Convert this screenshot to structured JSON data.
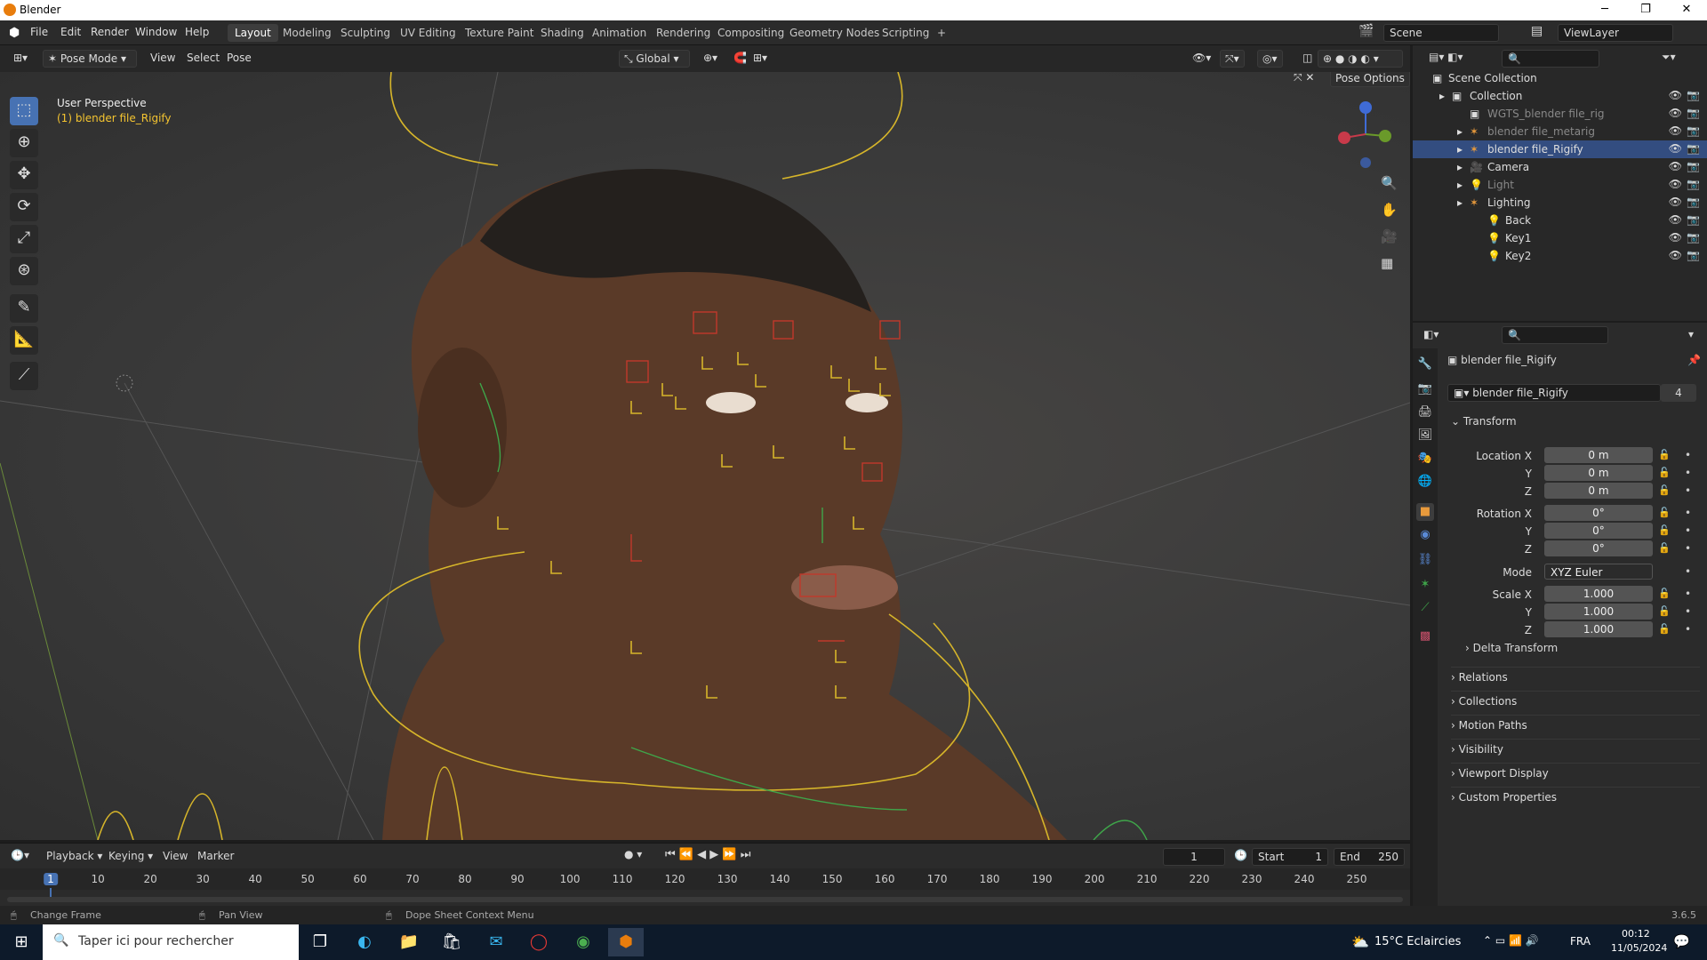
{
  "titlebar": {
    "title": "Blender",
    "min": "─",
    "max": "❐",
    "close": "✕"
  },
  "menus": [
    "File",
    "Edit",
    "Render",
    "Window",
    "Help"
  ],
  "workspaces": [
    "Layout",
    "Modeling",
    "Sculpting",
    "UV Editing",
    "Texture Paint",
    "Shading",
    "Animation",
    "Rendering",
    "Compositing",
    "Geometry Nodes",
    "Scripting",
    "+"
  ],
  "scene": {
    "label": "Scene",
    "viewlayer": "ViewLayer"
  },
  "viewport_header": {
    "mode": "Pose Mode",
    "view": "View",
    "select": "Select",
    "pose": "Pose",
    "orientation": "Global",
    "pose_options": "Pose Options",
    "x": "X"
  },
  "viewport": {
    "perspective": "User Perspective",
    "object": "(1) blender file_Rigify"
  },
  "outliner": {
    "root": "Scene Collection",
    "rows": [
      {
        "label": "Collection",
        "indent": 0,
        "type": "collection"
      },
      {
        "label": "WGTS_blender file_rig",
        "indent": 1,
        "type": "collection",
        "dim": true
      },
      {
        "label": "blender file_metarig",
        "indent": 1,
        "type": "armature",
        "dim": true
      },
      {
        "label": "blender file_Rigify",
        "indent": 1,
        "type": "armature",
        "selected": true
      },
      {
        "label": "Camera",
        "indent": 1,
        "type": "camera"
      },
      {
        "label": "Light",
        "indent": 1,
        "type": "light",
        "dim": true
      },
      {
        "label": "Lighting",
        "indent": 1,
        "type": "armature"
      },
      {
        "label": "Back",
        "indent": 2,
        "type": "light"
      },
      {
        "label": "Key1",
        "indent": 2,
        "type": "light"
      },
      {
        "label": "Key2",
        "indent": 2,
        "type": "light"
      }
    ]
  },
  "properties": {
    "object_name": "blender file_Rigify",
    "datablock": "blender file_Rigify",
    "users": "4",
    "transform_title": "Transform",
    "location": {
      "label": "Location X",
      "x": "0 m",
      "y": "0 m",
      "z": "0 m"
    },
    "rotation": {
      "label": "Rotation X",
      "x": "0°",
      "y": "0°",
      "z": "0°"
    },
    "mode": {
      "label": "Mode",
      "value": "XYZ Euler"
    },
    "scale": {
      "label": "Scale X",
      "x": "1.000",
      "y": "1.000",
      "z": "1.000"
    },
    "axis": {
      "y": "Y",
      "z": "Z"
    },
    "delta": "Delta Transform",
    "sections": [
      "Relations",
      "Collections",
      "Motion Paths",
      "Visibility",
      "Viewport Display",
      "Custom Properties"
    ]
  },
  "timeline": {
    "playback": "Playback",
    "keying": "Keying",
    "view": "View",
    "marker": "Marker",
    "current": "1",
    "start_label": "Start",
    "start": "1",
    "end_label": "End",
    "end": "250",
    "ticks": [
      "1",
      "10",
      "20",
      "30",
      "40",
      "50",
      "60",
      "70",
      "80",
      "90",
      "100",
      "110",
      "120",
      "130",
      "140",
      "150",
      "160",
      "170",
      "180",
      "190",
      "200",
      "210",
      "220",
      "230",
      "240",
      "250"
    ]
  },
  "statusbar": {
    "change_frame": "Change Frame",
    "pan_view": "Pan View",
    "context_menu": "Dope Sheet Context Menu",
    "version": "3.6.5"
  },
  "taskbar": {
    "search_placeholder": "Taper ici pour rechercher",
    "weather": "15°C Eclaircies",
    "lang": "FRA",
    "time": "00:12",
    "date": "11/05/2024"
  },
  "colors": {
    "accent": "#4772b3",
    "selected_row": "#334d80",
    "bone_yellow": "#d6b52a",
    "bone_red": "#c0392b",
    "bone_green": "#3fa64a"
  }
}
